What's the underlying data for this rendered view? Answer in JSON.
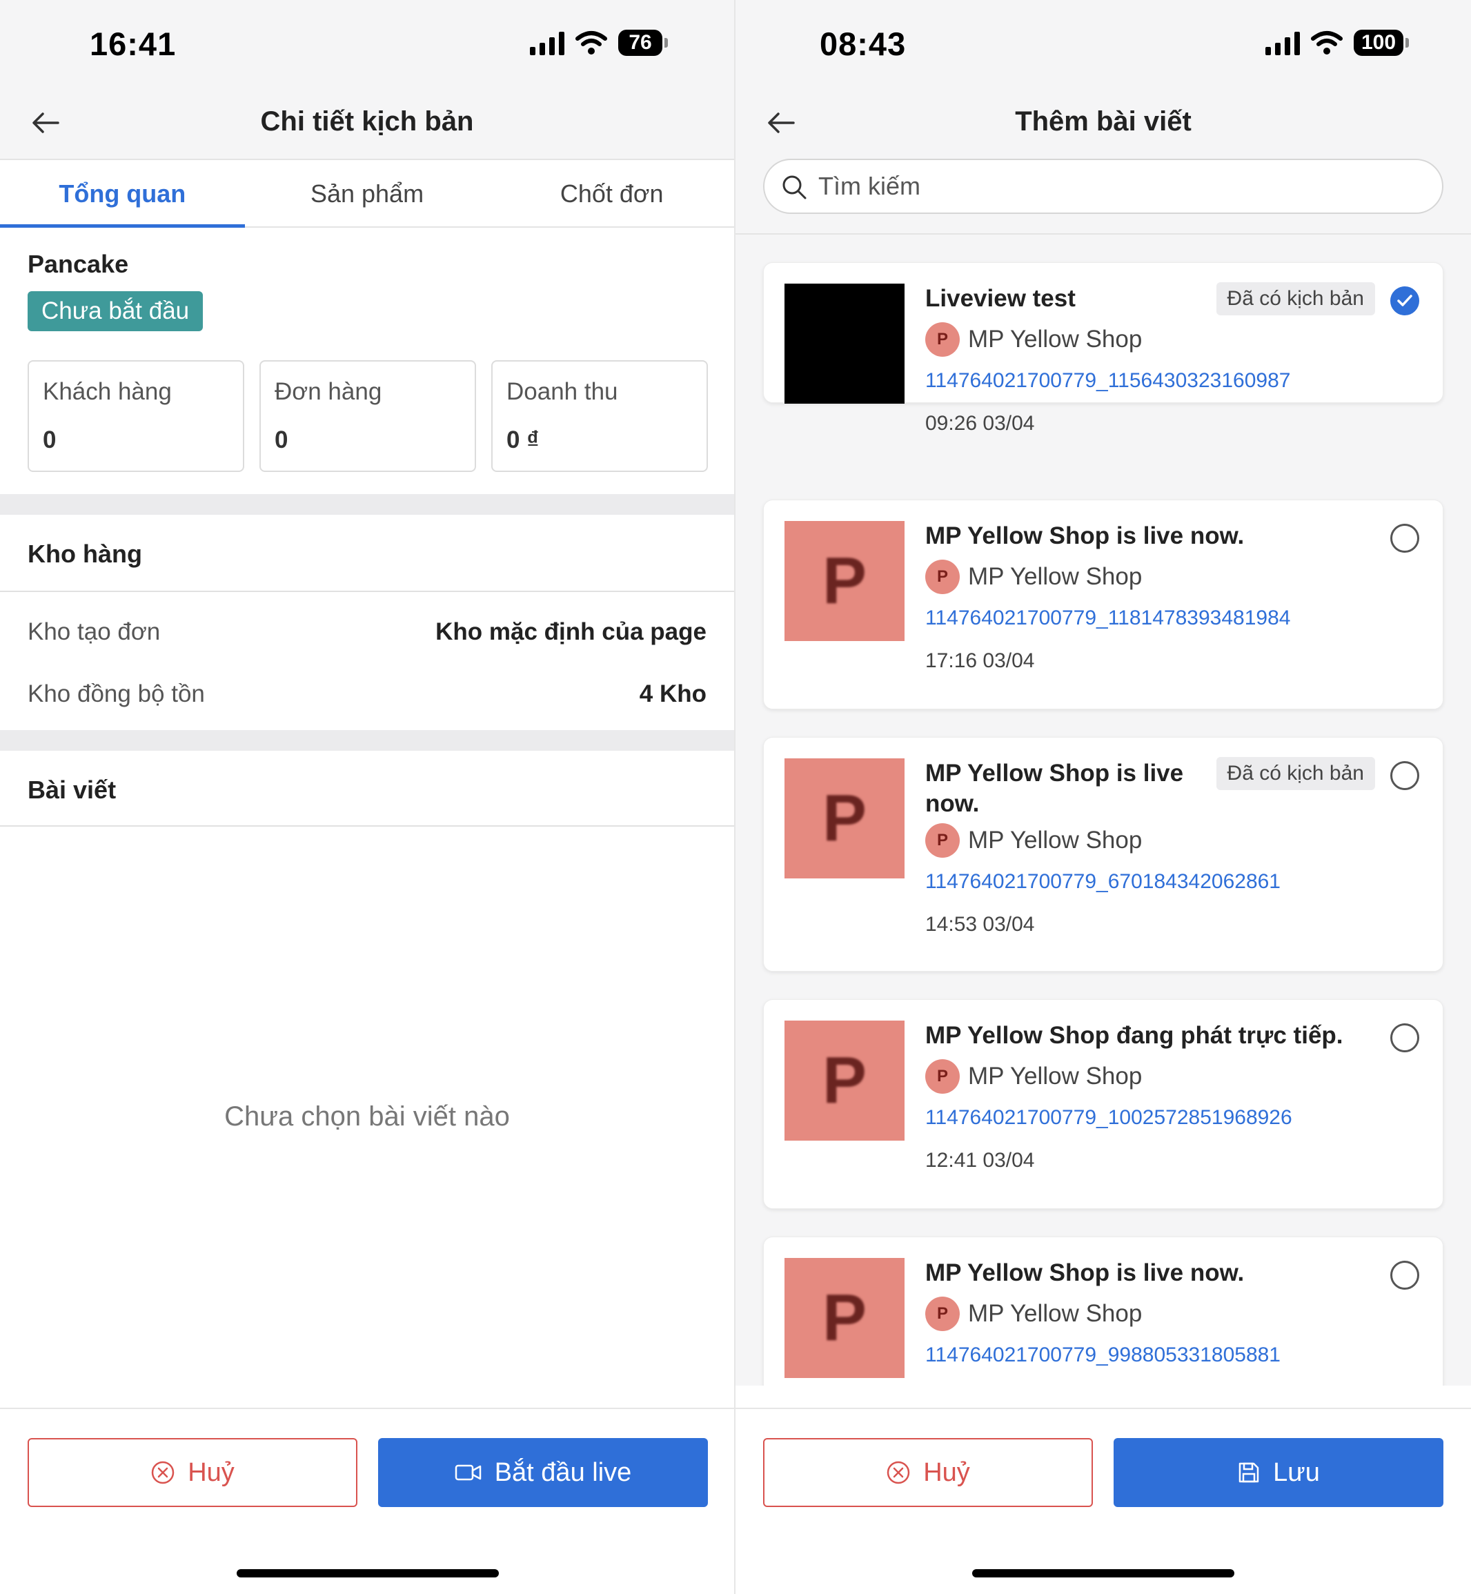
{
  "left": {
    "status": {
      "time": "16:41",
      "battery": "76"
    },
    "header": {
      "title": "Chi tiết kịch bản"
    },
    "tabs": [
      {
        "label": "Tổng quan",
        "active": true
      },
      {
        "label": "Sản phẩm",
        "active": false
      },
      {
        "label": "Chốt đơn",
        "active": false
      }
    ],
    "overview": {
      "page_name": "Pancake",
      "status_badge": "Chưa bắt đầu",
      "stats": [
        {
          "label": "Khách hàng",
          "value": "0"
        },
        {
          "label": "Đơn hàng",
          "value": "0"
        },
        {
          "label": "Doanh thu",
          "value": "0 ₫"
        }
      ]
    },
    "warehouse": {
      "title": "Kho hàng",
      "rows": [
        {
          "key": "Kho tạo đơn",
          "value": "Kho mặc định của page"
        },
        {
          "key": "Kho đồng bộ tồn",
          "value": "4 Kho"
        }
      ]
    },
    "posts": {
      "title": "Bài viết",
      "empty": "Chưa chọn bài viết nào"
    },
    "footer": {
      "cancel_label": "Huỷ",
      "primary_label": "Bắt đầu live"
    }
  },
  "right": {
    "status": {
      "time": "08:43",
      "battery": "100"
    },
    "header": {
      "title": "Thêm bài viết"
    },
    "search": {
      "placeholder": "Tìm kiếm"
    },
    "tag_label": "Đã có kịch bản",
    "posts": [
      {
        "title": "Liveview test",
        "shop": "MP Yellow Shop",
        "id": "114764021700779_1156430323160987",
        "time": "09:26 03/04",
        "thumb": "black",
        "has_script": true,
        "selected": true
      },
      {
        "title": "MP Yellow Shop is live now.",
        "shop": "MP Yellow Shop",
        "id": "114764021700779_1181478393481984",
        "time": "17:16 03/04",
        "thumb": "P",
        "has_script": false,
        "selected": false
      },
      {
        "title": "MP Yellow Shop is live now.",
        "shop": "MP Yellow Shop",
        "id": "114764021700779_670184342062861",
        "time": "14:53 03/04",
        "thumb": "P",
        "has_script": true,
        "selected": false
      },
      {
        "title": "MP Yellow Shop đang phát trực tiếp.",
        "shop": "MP Yellow Shop",
        "id": "114764021700779_1002572851968926",
        "time": "12:41 03/04",
        "thumb": "P",
        "has_script": false,
        "selected": false
      },
      {
        "title": "MP Yellow Shop is live now.",
        "shop": "MP Yellow Shop",
        "id": "114764021700779_998805331805881",
        "time": "",
        "thumb": "P",
        "has_script": false,
        "selected": false
      }
    ],
    "footer": {
      "cancel_label": "Huỷ",
      "primary_label": "Lưu"
    }
  },
  "icons": {
    "back": "arrow-left-icon",
    "search": "search-icon",
    "cancel": "circle-x-icon",
    "video": "video-camera-icon",
    "save": "floppy-disk-icon",
    "check": "check-icon"
  },
  "colors": {
    "primary": "#2f6fd8",
    "danger": "#d9534f",
    "status_badge": "#3f9a9a",
    "thumb_placeholder": "#e58a80"
  }
}
